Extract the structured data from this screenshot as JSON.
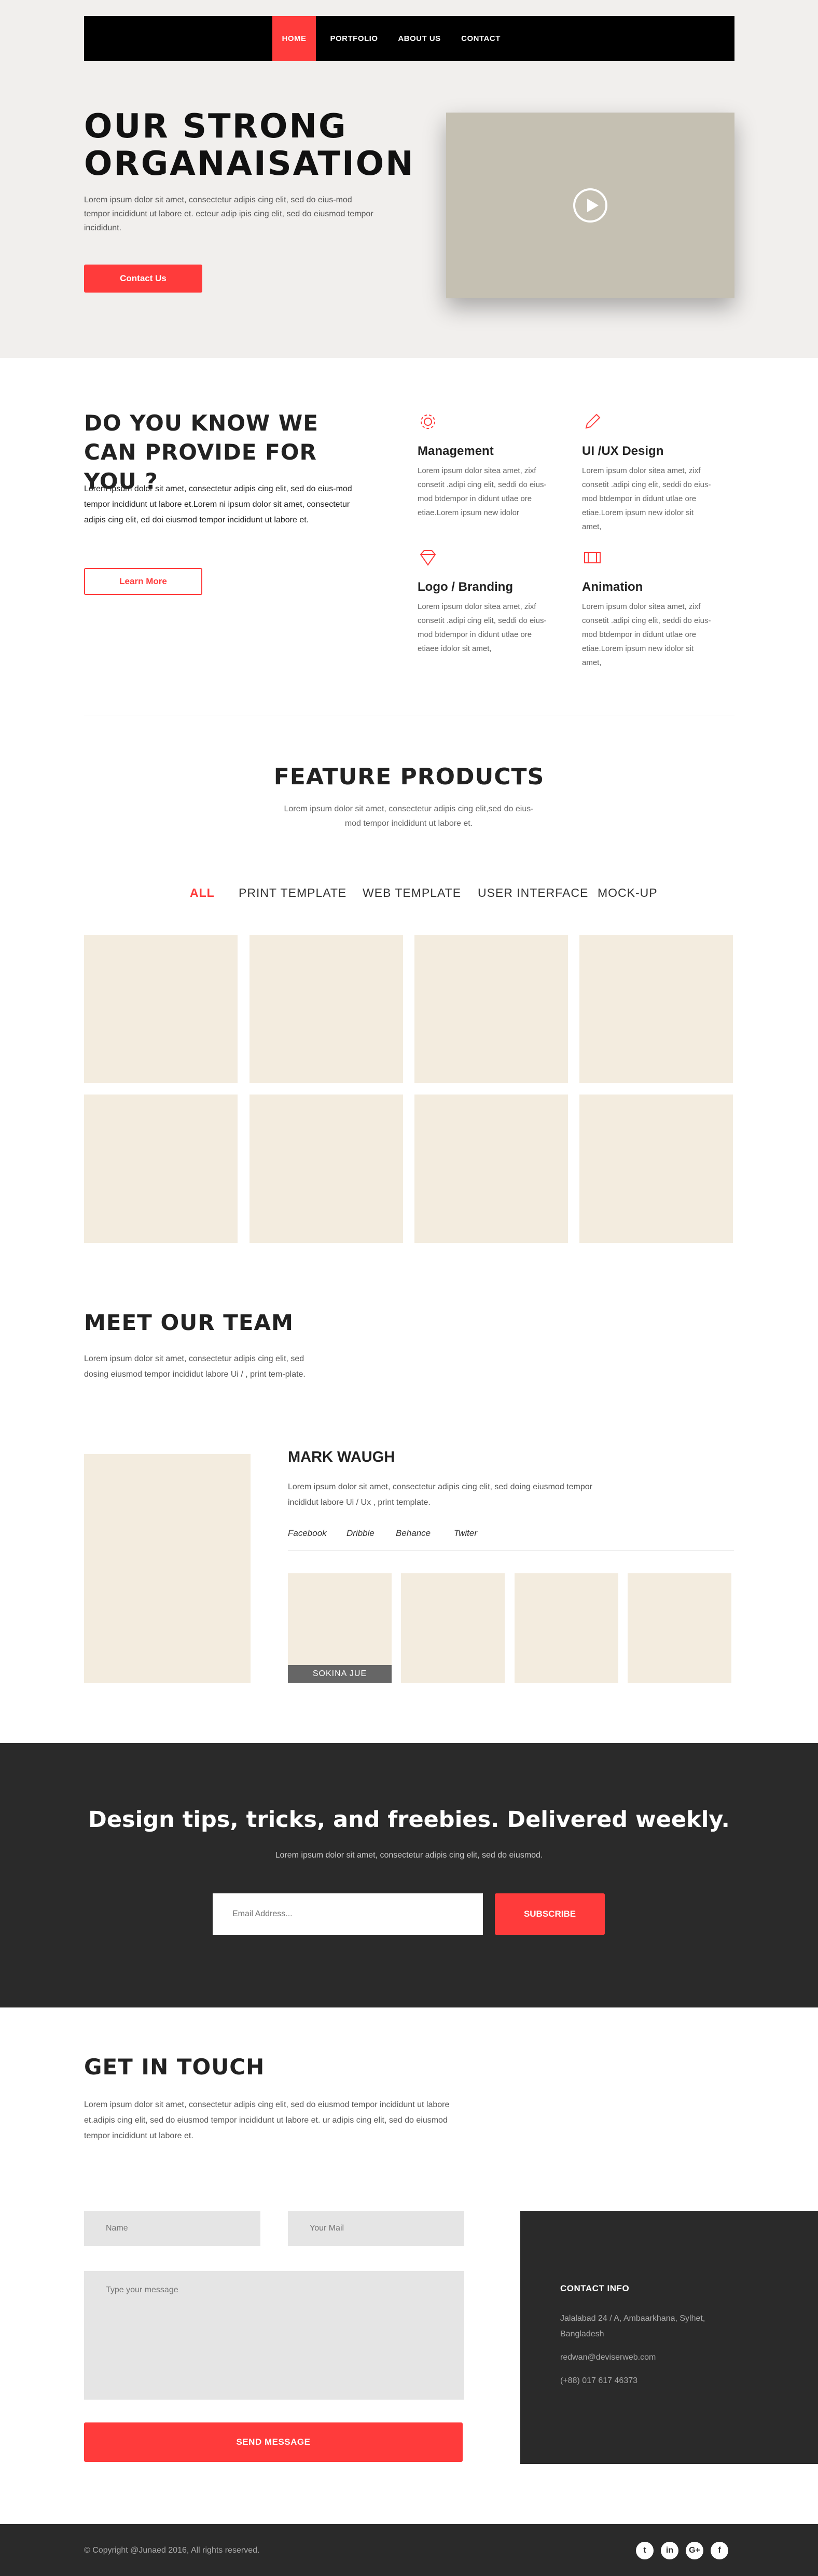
{
  "nav": {
    "items": [
      "HOME",
      "PORTFOLIO",
      "ABOUT US",
      "CONTACT"
    ],
    "active": "HOME"
  },
  "hero": {
    "title_line1": "OUR STRONG",
    "title_line2": "ORGANAISATION",
    "text": "Lorem ipsum dolor sit amet, consectetur adipis cing elit, sed do eius-mod tempor incididunt ut labore et. ecteur adip ipis cing elit, sed do eiusmod tempor incididunt.",
    "button": "Contact Us",
    "video_icon": "play-icon"
  },
  "services": {
    "title": "DO YOU KNOW WE CAN PROVIDE FOR YOU ?",
    "text": "Lorem ipsum dolor sit amet, consectetur adipis cing elit, sed do eius-mod tempor incididunt ut labore et.Lorem ni ipsum dolor sit amet, consectetur adipis cing elit, ed doi eiusmod tempor incididunt ut labore et.",
    "button": "Learn More",
    "items": [
      {
        "icon": "gear-icon",
        "title": "Management",
        "text": "Lorem ipsum dolor sitea amet, zixf consetit .adipi cing elit, seddi do eius-mod btdempor in didunt utlae ore etiae.Lorem ipsum new idolor"
      },
      {
        "icon": "pencil-icon",
        "title": "UI /UX Design",
        "text": "Lorem ipsum dolor sitea amet, zixf consetit .adipi cing elit, seddi do eius-mod btdempor in didunt utlae ore etiae.Lorem ipsum new idolor sit amet,"
      },
      {
        "icon": "diamond-icon",
        "title": "Logo / Branding",
        "text": "Lorem ipsum dolor sitea amet, zixf consetit .adipi cing elit, seddi do eius-mod btdempor in didunt utlae ore etiaee idolor sit amet,"
      },
      {
        "icon": "film-icon",
        "title": "Animation",
        "text": "Lorem ipsum dolor sitea amet, zixf consetit .adipi cing elit, seddi do eius-mod btdempor in didunt utlae ore etiae.Lorem ipsum new idolor sit amet,"
      }
    ]
  },
  "products": {
    "title": "FEATURE PRODUCTS",
    "subtitle": "Lorem ipsum dolor sit amet, consectetur adipis cing elit,sed do eius-mod tempor incididunt ut labore et.",
    "filters": [
      "ALL",
      "PRINT TEMPLATE",
      "WEB TEMPLATE",
      "USER INTERFACE",
      "MOCK-UP"
    ],
    "active_filter": "ALL"
  },
  "team": {
    "title": "MEET OUR TEAM",
    "text": "Lorem ipsum dolor sit amet, consectetur adipis cing elit, sed dosing eiusmod tempor incididut labore Ui / , print tem-plate.",
    "member_name": "MARK WAUGH",
    "member_bio": "Lorem ipsum dolor sit amet, consectetur adipis cing elit, sed doing eiusmod tempor incididut labore Ui / Ux , print template.",
    "socials": [
      "Facebook",
      "Dribble",
      "Behance",
      "Twiter"
    ],
    "thumb_label": "SOKINA JUE"
  },
  "newsletter": {
    "title": "Design tips, tricks, and freebies. Delivered weekly.",
    "subtitle": "Lorem ipsum dolor sit amet, consectetur adipis cing elit, sed do eiusmod.",
    "placeholder": "Email Address...",
    "button": "SUBSCRIBE"
  },
  "contact": {
    "title": "GET IN TOUCH",
    "text": "Lorem ipsum dolor sit amet, consectetur adipis cing elit, sed do eiusmod tempor incididunt ut labore et.adipis cing elit, sed do eiusmod tempor incididunt ut labore et. ur adipis cing elit, sed do eiusmod tempor incididunt ut labore et.",
    "name_placeholder": "Name",
    "mail_placeholder": "Your Mail",
    "message_placeholder": "Type your message",
    "button": "SEND MESSAGE",
    "info_title": "CONTACT INFO",
    "address": "Jalalabad 24 / A, Ambaarkhana, Sylhet, Bangladesh",
    "email": "redwan@deviserweb.com",
    "phone": "(+88) 017 617 46373"
  },
  "footer": {
    "copyright": "© Copyright @Junaed 2016, All rights reserved.",
    "socials": [
      {
        "icon": "twitter-icon",
        "glyph": "t"
      },
      {
        "icon": "linkedin-icon",
        "glyph": "in"
      },
      {
        "icon": "googleplus-icon",
        "glyph": "G+"
      },
      {
        "icon": "facebook-icon",
        "glyph": "f"
      }
    ]
  },
  "colors": {
    "accent": "#ff3b3b",
    "dark": "#2a2a2a",
    "tile": "#f3ecdf",
    "hero_bg": "#f1efed"
  }
}
